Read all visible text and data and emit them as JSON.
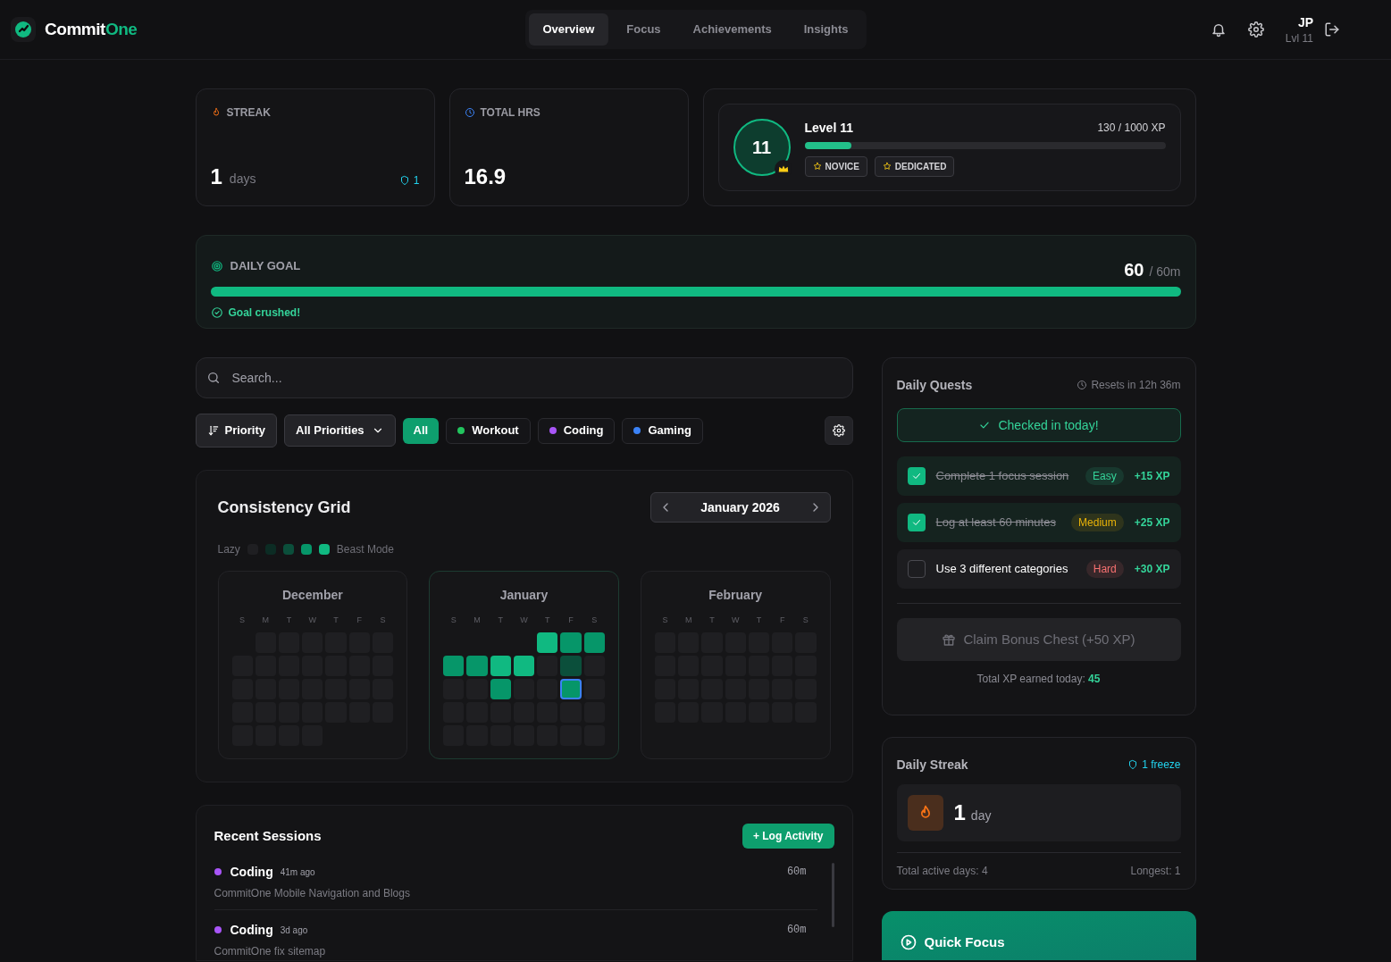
{
  "brand": {
    "first": "Commit",
    "second": "One"
  },
  "nav_tabs": [
    {
      "label": "Overview",
      "selected": true
    },
    {
      "label": "Focus",
      "selected": false
    },
    {
      "label": "Achievements",
      "selected": false
    },
    {
      "label": "Insights",
      "selected": false
    }
  ],
  "user": {
    "initials": "JP",
    "level": "Lvl 11"
  },
  "streak_card": {
    "title": "STREAK",
    "value": "1",
    "unit": "days",
    "freezes": "1"
  },
  "hours_card": {
    "title": "TOTAL HRS",
    "value": "16.9"
  },
  "level_card": {
    "badge": "11",
    "title": "Level 11",
    "xp": "130 / 1000 XP",
    "level": 0.13,
    "tags": [
      "NOVICE",
      "DEDICATED"
    ]
  },
  "daily_goal": {
    "title": "DAILY GOAL",
    "value": "60",
    "target": "/ 60m",
    "level": 1.0,
    "message": "Goal crushed!"
  },
  "search": {
    "placeholder": "Search..."
  },
  "sort_button": "Priority",
  "priority_select": "All Priorities",
  "filters": [
    {
      "label": "All",
      "selected": true
    },
    {
      "label": "Workout",
      "selected": false,
      "color": "#22c55e"
    },
    {
      "label": "Coding",
      "selected": false,
      "color": "#a855f7"
    },
    {
      "label": "Gaming",
      "selected": false,
      "color": "#3b82f6"
    }
  ],
  "consistency_grid": {
    "title": "Consistency Grid",
    "period": "January 2026",
    "legend_low": "Lazy",
    "legend_high": "Beast Mode",
    "legend_swatches": [
      {
        "color": "#1f1f22"
      },
      {
        "color": "#0c2c24"
      },
      {
        "color": "#0b4f3b"
      },
      {
        "color": "#069669"
      },
      {
        "color": "#10b981"
      }
    ],
    "months": [
      {
        "name": "December",
        "selected": false,
        "weekdays": [
          "S",
          "M",
          "T",
          "W",
          "T",
          "F",
          "S"
        ],
        "weeks": [
          [
            {
              "kind": "blank"
            },
            {
              "kind": "day",
              "color": "#1f1f22"
            },
            {
              "kind": "day",
              "color": "#1f1f22"
            },
            {
              "kind": "day",
              "color": "#1f1f22"
            },
            {
              "kind": "day",
              "color": "#1f1f22"
            },
            {
              "kind": "day",
              "color": "#1f1f22"
            },
            {
              "kind": "day",
              "color": "#1f1f22"
            }
          ],
          [
            {
              "kind": "day",
              "color": "#1f1f22"
            },
            {
              "kind": "day",
              "color": "#1f1f22"
            },
            {
              "kind": "day",
              "color": "#1f1f22"
            },
            {
              "kind": "day",
              "color": "#1f1f22"
            },
            {
              "kind": "day",
              "color": "#1f1f22"
            },
            {
              "kind": "day",
              "color": "#1f1f22"
            },
            {
              "kind": "day",
              "color": "#1f1f22"
            }
          ],
          [
            {
              "kind": "day",
              "color": "#1f1f22"
            },
            {
              "kind": "day",
              "color": "#1f1f22"
            },
            {
              "kind": "day",
              "color": "#1f1f22"
            },
            {
              "kind": "day",
              "color": "#1f1f22"
            },
            {
              "kind": "day",
              "color": "#1f1f22"
            },
            {
              "kind": "day",
              "color": "#1f1f22"
            },
            {
              "kind": "day",
              "color": "#1f1f22"
            }
          ],
          [
            {
              "kind": "day",
              "color": "#1f1f22"
            },
            {
              "kind": "day",
              "color": "#1f1f22"
            },
            {
              "kind": "day",
              "color": "#1f1f22"
            },
            {
              "kind": "day",
              "color": "#1f1f22"
            },
            {
              "kind": "day",
              "color": "#1f1f22"
            },
            {
              "kind": "day",
              "color": "#1f1f22"
            },
            {
              "kind": "day",
              "color": "#1f1f22"
            }
          ],
          [
            {
              "kind": "day",
              "color": "#1f1f22"
            },
            {
              "kind": "day",
              "color": "#1f1f22"
            },
            {
              "kind": "day",
              "color": "#1f1f22"
            },
            {
              "kind": "day",
              "color": "#1f1f22"
            }
          ]
        ]
      },
      {
        "name": "January",
        "selected": true,
        "weekdays": [
          "S",
          "M",
          "T",
          "W",
          "T",
          "F",
          "S"
        ],
        "weeks": [
          [
            {
              "kind": "blank"
            },
            {
              "kind": "blank"
            },
            {
              "kind": "blank"
            },
            {
              "kind": "blank"
            },
            {
              "kind": "day",
              "color": "#10b981"
            },
            {
              "kind": "day",
              "color": "#069669"
            },
            {
              "kind": "day",
              "color": "#069669"
            }
          ],
          [
            {
              "kind": "day",
              "color": "#069669"
            },
            {
              "kind": "day",
              "color": "#069669"
            },
            {
              "kind": "day",
              "color": "#10b981"
            },
            {
              "kind": "day",
              "color": "#10b981"
            },
            {
              "kind": "day",
              "color": "#1f1f22"
            },
            {
              "kind": "day",
              "color": "#0b4f3b"
            },
            {
              "kind": "day",
              "color": "#1f1f22"
            }
          ],
          [
            {
              "kind": "day",
              "color": "#1f1f22"
            },
            {
              "kind": "day",
              "color": "#1f1f22"
            },
            {
              "kind": "day",
              "color": "#069669"
            },
            {
              "kind": "day",
              "color": "#1f1f22"
            },
            {
              "kind": "day",
              "color": "#1f1f22"
            },
            {
              "kind": "today",
              "color": "#069669"
            },
            {
              "kind": "day",
              "color": "#1f1f22"
            }
          ],
          [
            {
              "kind": "day",
              "color": "#1f1f22"
            },
            {
              "kind": "day",
              "color": "#1f1f22"
            },
            {
              "kind": "day",
              "color": "#1f1f22"
            },
            {
              "kind": "day",
              "color": "#1f1f22"
            },
            {
              "kind": "day",
              "color": "#1f1f22"
            },
            {
              "kind": "day",
              "color": "#1f1f22"
            },
            {
              "kind": "day",
              "color": "#1f1f22"
            }
          ],
          [
            {
              "kind": "day",
              "color": "#1f1f22"
            },
            {
              "kind": "day",
              "color": "#1f1f22"
            },
            {
              "kind": "day",
              "color": "#1f1f22"
            },
            {
              "kind": "day",
              "color": "#1f1f22"
            },
            {
              "kind": "day",
              "color": "#1f1f22"
            },
            {
              "kind": "day",
              "color": "#1f1f22"
            },
            {
              "kind": "day",
              "color": "#1f1f22"
            }
          ]
        ]
      },
      {
        "name": "February",
        "selected": false,
        "weekdays": [
          "S",
          "M",
          "T",
          "W",
          "T",
          "F",
          "S"
        ],
        "weeks": [
          [
            {
              "kind": "day",
              "color": "#1f1f22"
            },
            {
              "kind": "day",
              "color": "#1f1f22"
            },
            {
              "kind": "day",
              "color": "#1f1f22"
            },
            {
              "kind": "day",
              "color": "#1f1f22"
            },
            {
              "kind": "day",
              "color": "#1f1f22"
            },
            {
              "kind": "day",
              "color": "#1f1f22"
            },
            {
              "kind": "day",
              "color": "#1f1f22"
            }
          ],
          [
            {
              "kind": "day",
              "color": "#1f1f22"
            },
            {
              "kind": "day",
              "color": "#1f1f22"
            },
            {
              "kind": "day",
              "color": "#1f1f22"
            },
            {
              "kind": "day",
              "color": "#1f1f22"
            },
            {
              "kind": "day",
              "color": "#1f1f22"
            },
            {
              "kind": "day",
              "color": "#1f1f22"
            },
            {
              "kind": "day",
              "color": "#1f1f22"
            }
          ],
          [
            {
              "kind": "day",
              "color": "#1f1f22"
            },
            {
              "kind": "day",
              "color": "#1f1f22"
            },
            {
              "kind": "day",
              "color": "#1f1f22"
            },
            {
              "kind": "day",
              "color": "#1f1f22"
            },
            {
              "kind": "day",
              "color": "#1f1f22"
            },
            {
              "kind": "day",
              "color": "#1f1f22"
            },
            {
              "kind": "day",
              "color": "#1f1f22"
            }
          ],
          [
            {
              "kind": "day",
              "color": "#1f1f22"
            },
            {
              "kind": "day",
              "color": "#1f1f22"
            },
            {
              "kind": "day",
              "color": "#1f1f22"
            },
            {
              "kind": "day",
              "color": "#1f1f22"
            },
            {
              "kind": "day",
              "color": "#1f1f22"
            },
            {
              "kind": "day",
              "color": "#1f1f22"
            },
            {
              "kind": "day",
              "color": "#1f1f22"
            }
          ]
        ]
      }
    ]
  },
  "recent_sessions": {
    "title": "Recent Sessions",
    "action": "+ Log Activity",
    "items": [
      {
        "category": "Coding",
        "color": "#a855f7",
        "ago": "41m ago",
        "description": "CommitOne Mobile Navigation and Blogs",
        "duration": "60m"
      },
      {
        "category": "Coding",
        "color": "#a855f7",
        "ago": "3d ago",
        "description": "CommitOne fix sitemap",
        "duration": "60m"
      }
    ]
  },
  "daily_quests": {
    "title": "Daily Quests",
    "resets": "Resets in 12h 36m",
    "checkin": "Checked in today!",
    "quests": [
      {
        "text": "Complete 1 focus session",
        "checked": true,
        "difficulty": "Easy",
        "color": "#34d399",
        "xp": "+15 XP"
      },
      {
        "text": "Log at least 60 minutes",
        "checked": true,
        "difficulty": "Medium",
        "color": "#eab308",
        "xp": "+25 XP"
      },
      {
        "text": "Use 3 different categories",
        "checked": false,
        "difficulty": "Hard",
        "color": "#f87171",
        "xp": "+30 XP"
      }
    ],
    "bonus_button": "Claim Bonus Chest (+50 XP)",
    "bonus_disabled": true,
    "total_label": "Total XP earned today:",
    "total_value": "45"
  },
  "daily_streak": {
    "title": "Daily Streak",
    "freeze": "1 freeze",
    "value": "1",
    "unit": "day",
    "active_days": "Total active days: 4",
    "longest": "Longest: 1"
  },
  "quick_focus": {
    "title": "Quick Focus"
  }
}
